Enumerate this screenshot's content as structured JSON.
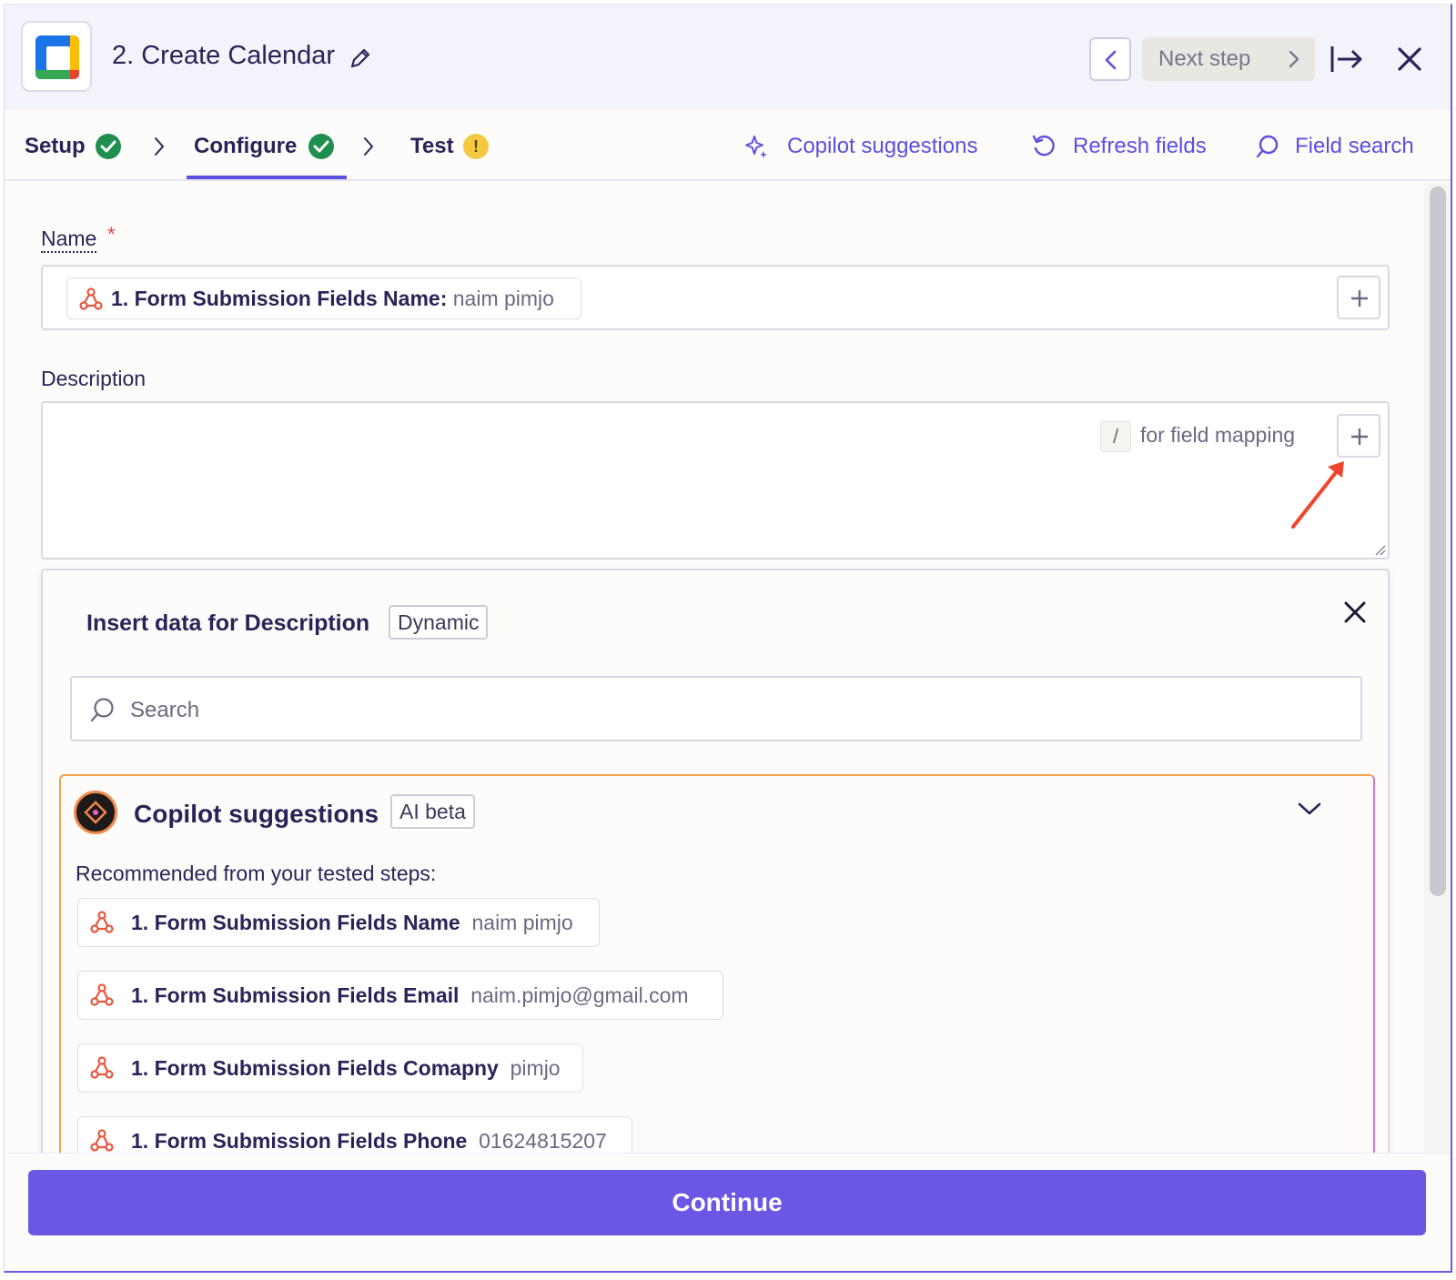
{
  "header": {
    "title": "2. Create Calendar",
    "next_step_label": "Next step",
    "app_icon": "google-calendar-icon"
  },
  "tabs": [
    {
      "label": "Setup",
      "status": "complete"
    },
    {
      "label": "Configure",
      "status": "complete",
      "active": true
    },
    {
      "label": "Test",
      "status": "warning",
      "status_glyph": "!"
    }
  ],
  "tools": {
    "copilot": "Copilot suggestions",
    "refresh": "Refresh fields",
    "search": "Field search"
  },
  "form": {
    "name_label": "Name",
    "name_required_mark": "*",
    "name_pill_key": "1. Form Submission Fields Name:",
    "name_pill_value": "naim pimjo",
    "description_label": "Description",
    "slash_key": "/",
    "description_hint": "for field mapping"
  },
  "insert_panel": {
    "title": "Insert data for Description",
    "mode_badge": "Dynamic",
    "search_placeholder": "Search",
    "copilot": {
      "title": "Copilot suggestions",
      "badge": "AI beta",
      "recommended_label": "Recommended from your tested steps:",
      "suggestions": [
        {
          "key": "1. Form Submission Fields Name",
          "value": "naim pimjo"
        },
        {
          "key": "1. Form Submission Fields Email",
          "value": "naim.pimjo@gmail.com"
        },
        {
          "key": "1. Form Submission Fields Comapny",
          "value": "pimjo"
        },
        {
          "key": "1. Form Submission Fields Phone",
          "value": "01624815207"
        }
      ]
    }
  },
  "footer": {
    "continue_label": "Continue"
  },
  "colors": {
    "accent": "#5b4fe0",
    "continue_bg": "#6a57e3",
    "check_green": "#1e8f4e",
    "warning_yellow": "#f5c842",
    "webhook_orange": "#e8553e",
    "annotation_arrow": "#f0442c"
  }
}
